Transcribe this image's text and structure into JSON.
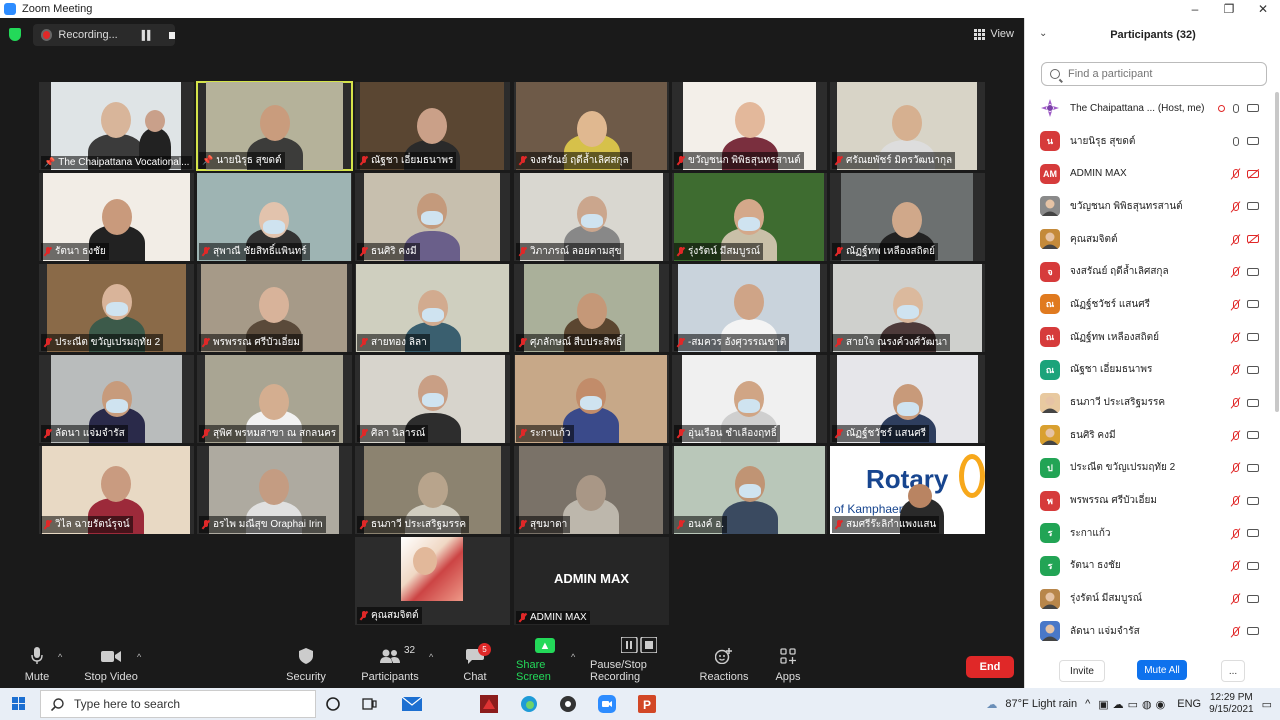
{
  "window": {
    "title": "Zoom Meeting",
    "controls": [
      "–",
      "❐",
      "✕"
    ]
  },
  "recording": {
    "label": "Recording..."
  },
  "view": {
    "label": "View"
  },
  "tiles": [
    {
      "name": "The Chaipattana Vocational...",
      "pinned": true,
      "muted": false
    },
    {
      "name": "นายนิรุธ สุขดต์",
      "pinned": true,
      "muted": false,
      "speaking": true
    },
    {
      "name": "ณัฐชา เอี่ยมธนาพร",
      "muted": true
    },
    {
      "name": "จงสรัณย์ ฤดีล้ำเลิศสกุล",
      "muted": true
    },
    {
      "name": "ขวัญชนก พิพิธสุนทรสานต์",
      "muted": true
    },
    {
      "name": "ศรัณยพัชร์ มิตรวัฒนากุล",
      "muted": true
    },
    {
      "name": "รัตนา  ธงชัย",
      "muted": true
    },
    {
      "name": "สุพาณี ชัยสิทธิ์แพินทร์",
      "muted": true
    },
    {
      "name": "ธนศิริ คงมี",
      "muted": true
    },
    {
      "name": "วิภาภรณ์ ลอยตามสุข",
      "muted": true
    },
    {
      "name": "รุ่งรัตน์ มีสมบูรณ์",
      "muted": true
    },
    {
      "name": "ณัฏฐ์ทพ เหลืองสถิตย์",
      "muted": true
    },
    {
      "name": "ประณีต ขวัญเปรมฤทัย 2",
      "muted": true
    },
    {
      "name": "พรพรรณ ศรีบัวเอี่ยม",
      "muted": true
    },
    {
      "name": "สายทอง  ลิลา",
      "muted": true
    },
    {
      "name": "ศุภลักษณ์ สืบประสิทธิ์",
      "muted": true
    },
    {
      "name": "-สมควร อังศุวรรณชาติ",
      "muted": true
    },
    {
      "name": "สายใจ ณรงค์วงศ์วัฒนา",
      "muted": true
    },
    {
      "name": "ลัดนา แจ่มจำรัส",
      "muted": true
    },
    {
      "name": "สุพิศ พรหมสาขา ณ สกลนคร",
      "muted": true
    },
    {
      "name": "ศิลา นิลารณ์",
      "muted": true
    },
    {
      "name": "ระกาแก้ว",
      "muted": true
    },
    {
      "name": "อุ่นเรือน ชำเลืองฤทธิ์",
      "muted": true
    },
    {
      "name": "ณัฏฐ์ชวัชร์ แสนศรี",
      "muted": true
    },
    {
      "name": "วิไล ฉายรัตน์รุจน์",
      "muted": true
    },
    {
      "name": "อรไพ มณีสุข Oraphai Irin",
      "muted": true
    },
    {
      "name": "ธนภาวี ประเสริฐมรรค",
      "muted": true
    },
    {
      "name": "สุขมาดา",
      "muted": true
    },
    {
      "name": "อนงค์ อ.",
      "muted": true
    },
    {
      "name": "สมศรีร๊ะลิกำแพงแสน",
      "muted": true
    },
    {
      "name": "คุณสมจิตต์",
      "muted": true
    },
    {
      "name": "ADMIN MAX",
      "muted": true,
      "big_label": "ADMIN MAX"
    }
  ],
  "rotary": {
    "text": "Rotary",
    "sub": "of Kamphaeng..."
  },
  "toolbar": {
    "mute": "Mute",
    "stop_video": "Stop Video",
    "security": "Security",
    "participants": "Participants",
    "participants_count": "32",
    "chat": "Chat",
    "chat_badge": "5",
    "share_screen": "Share Screen",
    "pause_stop_recording": "Pause/Stop Recording",
    "reactions": "Reactions",
    "apps": "Apps",
    "end": "End"
  },
  "panel": {
    "title": "Participants (32)",
    "search_placeholder": "Find a participant",
    "invite": "Invite",
    "mute_all": "Mute All",
    "more": "...",
    "participants": [
      {
        "name": "The Chaipattana ... (Host, me)",
        "initial": "",
        "color": "#ffffff",
        "mic": "on",
        "cam": "on",
        "rec": true,
        "avatar": "logo"
      },
      {
        "name": "นายนิรุธ สุขดต์",
        "initial": "น",
        "color": "#d63b3b",
        "mic": "on",
        "cam": "on"
      },
      {
        "name": "ADMIN MAX",
        "initial": "AM",
        "color": "#d63b3b",
        "mic": "off",
        "cam": "off"
      },
      {
        "name": "ขวัญชนก พิพิธสุนทรสานต์",
        "initial": "",
        "color": "#8a8a8a",
        "mic": "off",
        "cam": "on",
        "avatar": "photo"
      },
      {
        "name": "คุณสมจิตต์",
        "initial": "",
        "color": "#c48a3a",
        "mic": "off",
        "cam": "off",
        "avatar": "photo"
      },
      {
        "name": "จงสรัณย์ ฤดีล้ำเลิศสกุล",
        "initial": "จ",
        "color": "#d63b3b",
        "mic": "off",
        "cam": "on"
      },
      {
        "name": "ณัฏฐ์ชวัชร์ แสนศรี",
        "initial": "ณ",
        "color": "#e07a1f",
        "mic": "off",
        "cam": "on"
      },
      {
        "name": "ณัฏฐ์ทพ เหลืองสถิตย์",
        "initial": "ณ",
        "color": "#d63b3b",
        "mic": "off",
        "cam": "on"
      },
      {
        "name": "ณัฐชา เอี่ยมธนาพร",
        "initial": "ณ",
        "color": "#1ba37a",
        "mic": "off",
        "cam": "on"
      },
      {
        "name": "ธนภาวี ประเสริฐมรรค",
        "initial": "",
        "color": "#e8c9a0",
        "mic": "off",
        "cam": "on",
        "avatar": "photo"
      },
      {
        "name": "ธนศิริ คงมี",
        "initial": "",
        "color": "#d9a030",
        "mic": "off",
        "cam": "on",
        "avatar": "photo"
      },
      {
        "name": "ประณีต ขวัญเปรมฤทัย 2",
        "initial": "ป",
        "color": "#22a455",
        "mic": "off",
        "cam": "on"
      },
      {
        "name": "พรพรรณ ศรีบัวเอี่ยม",
        "initial": "พ",
        "color": "#d63b3b",
        "mic": "off",
        "cam": "on"
      },
      {
        "name": "ระกาแก้ว",
        "initial": "ร",
        "color": "#22a455",
        "mic": "off",
        "cam": "on"
      },
      {
        "name": "รัตนา  ธงชัย",
        "initial": "ร",
        "color": "#22a455",
        "mic": "off",
        "cam": "on"
      },
      {
        "name": "รุ่งรัตน์ มีสมบูรณ์",
        "initial": "",
        "color": "#b8864a",
        "mic": "off",
        "cam": "on",
        "avatar": "photo"
      },
      {
        "name": "ลัดนา แจ่มจำรัส",
        "initial": "",
        "color": "#4a78c8",
        "mic": "off",
        "cam": "on",
        "avatar": "photo"
      }
    ]
  },
  "taskbar": {
    "search_placeholder": "Type here to search",
    "weather": "87°F  Light rain",
    "lang": "ENG",
    "time": "12:29 PM",
    "date": "9/15/2021"
  }
}
